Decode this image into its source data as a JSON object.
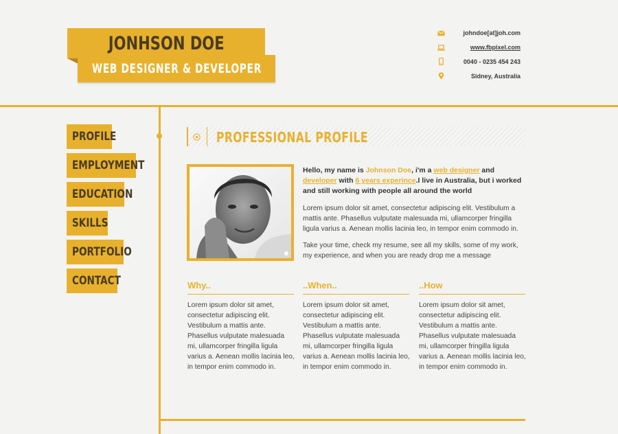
{
  "header": {
    "name": "JONHSON DOE",
    "subtitle": "WEB DESIGNER & DEVELOPER"
  },
  "contact": {
    "email": "johndoe[at]joh.com",
    "website": "www.fbpixel.com",
    "phone": "0040 - 0235 454 243",
    "location": "Sidney, Australia"
  },
  "nav": {
    "items": [
      {
        "label": "PROFILE"
      },
      {
        "label": "EMPLOYMENT"
      },
      {
        "label": "EDUCATION"
      },
      {
        "label": "SKILLS"
      },
      {
        "label": "PORTFOLIO"
      },
      {
        "label": "CONTACT"
      }
    ]
  },
  "section": {
    "title": "PROFESSIONAL PROFILE"
  },
  "intro": {
    "p1": "Hello, my name is ",
    "name": "Johnson Doe",
    "p2": ", i'm a ",
    "link1": "web designer",
    "p3": " and ",
    "link2": "developer",
    "p4": " with ",
    "link3": "6 years experince",
    "p5": ".I live in Australia, but i worked and still working with people all around the world"
  },
  "paragraphs": {
    "lorem": "Lorem ipsum dolor sit amet, consectetur adipiscing elit. Vestibulum a mattis ante. Phasellus vulputate malesuada mi, ullamcorper fringilla ligula varius a. Aenean mollis lacinia leo, in tempor enim commodo in.",
    "cta": "Take your time, check my resume, see all my skills, some of my work, my experience, and when you are ready drop me a message"
  },
  "columns": [
    {
      "title": "Why..",
      "text": "Lorem ipsum dolor sit amet, consectetur adipiscing elit. Vestibulum a mattis ante. Phasellus vulputate malesuada mi, ullamcorper fringilla ligula varius a. Aenean mollis lacinia leo, in tempor enim commodo in."
    },
    {
      "title": "..When..",
      "text": "Lorem ipsum dolor sit amet, consectetur adipiscing elit. Vestibulum a mattis ante. Phasellus vulputate malesuada mi, ullamcorper fringilla ligula varius a. Aenean mollis lacinia leo, in tempor enim commodo in."
    },
    {
      "title": "..How",
      "text": "Lorem ipsum dolor sit amet, consectetur adipiscing elit. Vestibulum a mattis ante. Phasellus vulputate malesuada mi, ullamcorper fringilla ligula varius a. Aenean mollis lacinia leo, in tempor enim commodo in."
    }
  ],
  "icons": {
    "email": "envelope-icon",
    "website": "laptop-icon",
    "phone": "phone-icon",
    "location": "map-pin-icon",
    "section": "target-icon"
  },
  "colors": {
    "accent": "#e8b12d",
    "dark_text": "#4a3c22",
    "background": "#f3f3f2"
  }
}
